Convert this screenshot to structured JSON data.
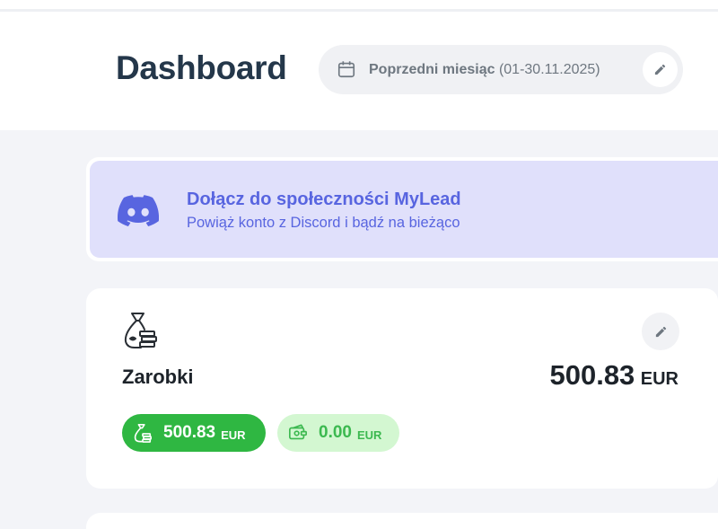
{
  "header": {
    "title": "Dashboard",
    "date_range": {
      "label": "Poprzedni miesiąc",
      "range": "(01-30.11.2025)"
    }
  },
  "discord_banner": {
    "title": "Dołącz do społeczności MyLead",
    "subtitle": "Powiąż konto z Discord i bądź na bieżąco",
    "icon": "discord-icon"
  },
  "earnings": {
    "label": "Zarobki",
    "total": "500.83",
    "currency": "EUR",
    "icon": "money-bag-icon",
    "badges": [
      {
        "value": "500.83",
        "currency": "EUR",
        "icon": "money-bag-icon",
        "color": "#2fb742"
      },
      {
        "value": "0.00",
        "currency": "EUR",
        "icon": "wallet-cash-icon",
        "color": "#d3f7d1"
      }
    ]
  },
  "colors": {
    "title": "#24374a",
    "discord_accent": "#5865e0",
    "discord_bg": "#e0e0fb",
    "page_bg": "#f3f4f8"
  }
}
